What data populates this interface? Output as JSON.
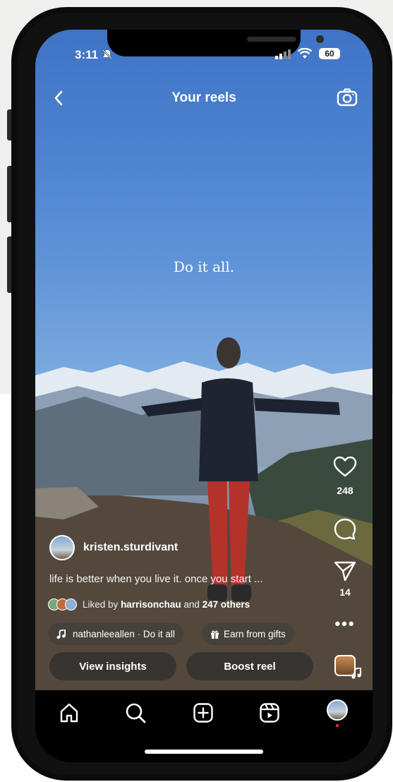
{
  "status_bar": {
    "time": "3:11",
    "battery": "60"
  },
  "header": {
    "title": "Your reels",
    "back_icon": "chevron-left-icon",
    "camera_icon": "camera-icon"
  },
  "video": {
    "overlay_text": "Do it all."
  },
  "actions": {
    "like_count": "248",
    "share_count": "14"
  },
  "author": {
    "username": "kristen.sturdivant"
  },
  "caption": {
    "text": "life is better when you live it. once you start ..."
  },
  "likes": {
    "prefix": "Liked by",
    "user": "harrisonchau",
    "suffix": "and",
    "others": "247 others"
  },
  "audio": {
    "label": "nathanleeallen · Do it all"
  },
  "gifts": {
    "label": "Earn from gifts"
  },
  "buttons": {
    "insights": "View insights",
    "boost": "Boost reel"
  },
  "tabbar": {
    "items": [
      "home-icon",
      "search-icon",
      "create-icon",
      "reels-icon",
      "profile-avatar"
    ]
  },
  "colors": {
    "accent_red": "#ff3040",
    "sky": "#4d82d0"
  }
}
